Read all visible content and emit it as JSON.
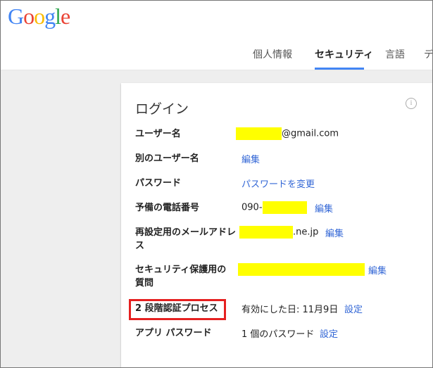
{
  "logo": {
    "letters": [
      {
        "ch": "G",
        "color": "#4285f4"
      },
      {
        "ch": "o",
        "color": "#ea4335"
      },
      {
        "ch": "o",
        "color": "#fbbc05"
      },
      {
        "ch": "g",
        "color": "#4285f4"
      },
      {
        "ch": "l",
        "color": "#34a853"
      },
      {
        "ch": "e",
        "color": "#ea4335"
      }
    ]
  },
  "tabs": [
    {
      "label": "個人情報"
    },
    {
      "label": "セキュリティ"
    },
    {
      "label": "言語"
    },
    {
      "label": "デ"
    }
  ],
  "card": {
    "title": "ログイン",
    "info_icon": "i",
    "rows": {
      "username": {
        "label": "ユーザー名",
        "value_suffix": "@gmail.com"
      },
      "alt_username": {
        "label": "別のユーザー名",
        "action": "編集"
      },
      "password": {
        "label": "パスワード",
        "action": "パスワードを変更"
      },
      "backup_phone": {
        "label": "予備の電話番号",
        "value_prefix": "090-",
        "action": "編集"
      },
      "recovery_email": {
        "label": "再設定用のメールアドレス",
        "value_suffix": ".ne.jp",
        "action": "編集"
      },
      "security_question": {
        "label": "セキュリティ保護用の質問",
        "action": "編集"
      },
      "two_step": {
        "label": "2 段階認証プロセス",
        "value": "有効にした日: 11月9日",
        "action": "設定"
      },
      "app_password": {
        "label": "アプリ パスワード",
        "value": "1 個のパスワード",
        "action": "設定"
      }
    }
  },
  "colors": {
    "accent": "#4285f4",
    "link": "#3367d6",
    "redaction": "#ffff00",
    "highlight": "#e52020"
  }
}
